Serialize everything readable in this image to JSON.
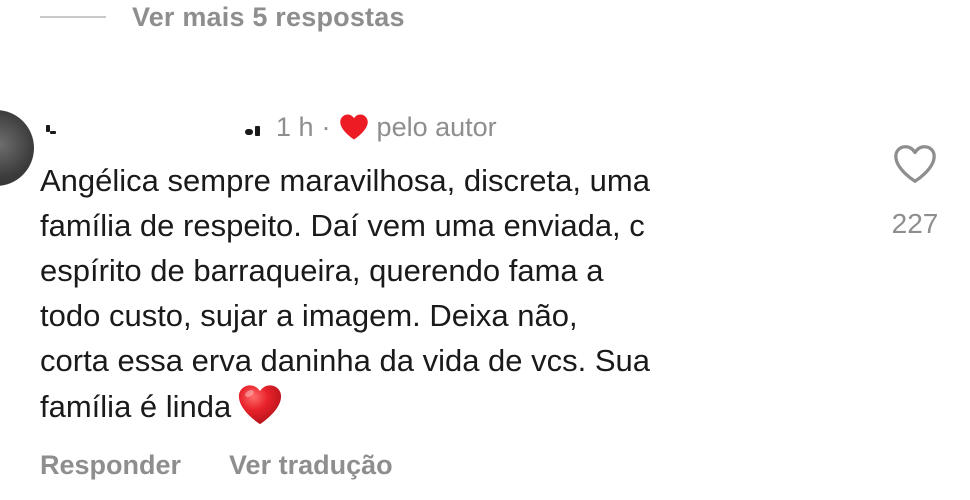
{
  "thread": {
    "more_replies_label": "Ver mais 5 respostas"
  },
  "comment": {
    "time": "1 h",
    "separator": "·",
    "liked_by_author_label": "pelo autor",
    "text_lines": [
      "Angélica sempre maravilhosa, discreta, uma",
      "família de respeito. Daí vem uma enviada, c",
      "espírito de barraqueira, querendo fama a",
      "todo custo, sujar a imagem. Deixa não,",
      "corta essa erva daninha da vida de vcs. Sua",
      "família é linda"
    ],
    "emoji": "red-heart-emoji",
    "like_count": "227",
    "reply_label": "Responder",
    "translate_label": "Ver tradução"
  },
  "icons": {
    "like": "heart-outline-icon",
    "author_like": "heart-filled-icon"
  },
  "colors": {
    "muted_text": "#8e8e8e",
    "body_text": "#1a1a1a",
    "heart_red": "#ed1c24"
  }
}
